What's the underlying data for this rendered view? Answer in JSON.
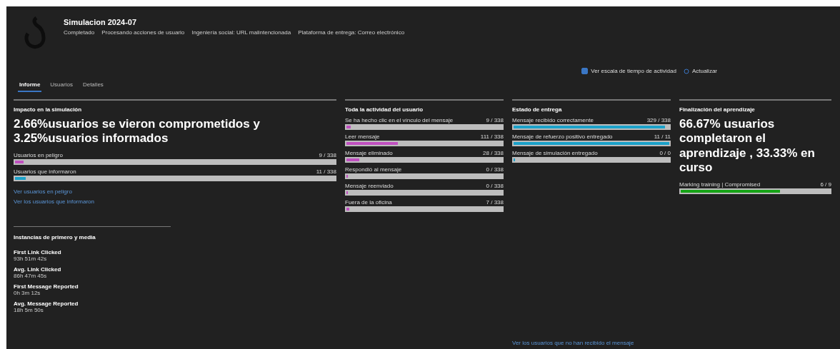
{
  "header": {
    "title": "Simulacion 2024-07",
    "meta": [
      "Completado",
      "Procesando acciones de usuario",
      "Ingeniería social: URL malintencionada",
      "Plataforma de entrega: Correo electrónico"
    ]
  },
  "toolbar": {
    "timeline": {
      "label": "Ver escala de tiempo de actividad",
      "checked": true
    },
    "refresh": "Actualizar"
  },
  "tabs": [
    {
      "label": "Informe",
      "selected": true
    },
    {
      "label": "Usuarios",
      "selected": false
    },
    {
      "label": "Detalles",
      "selected": false
    }
  ],
  "impact": {
    "title": "Impacto en la simulación",
    "headline": "2.66%usuarios se vieron comprometidos y 3.25%usuarios informados",
    "bars": [
      {
        "label": "Usuarios en peligro",
        "value": "9 / 338",
        "level": 0.027,
        "color": "#c050c0"
      },
      {
        "label": "Usuarios que informaron",
        "value": "11 / 338",
        "level": 0.033,
        "color": "#1ba1c9"
      }
    ],
    "links": [
      "Ver usuarios en peligro",
      "Ver los usuarios que informaron"
    ]
  },
  "timing": {
    "title": "Instancias de primero y media",
    "items": [
      {
        "label": "First Link Clicked",
        "value": "93h 51m 42s"
      },
      {
        "label": "Avg. Link Clicked",
        "value": "86h 47m 45s"
      },
      {
        "label": "First Message Reported",
        "value": "0h 3m 12s"
      },
      {
        "label": "Avg. Message Reported",
        "value": "18h 5m 50s"
      }
    ]
  },
  "activity": {
    "title": "Toda la actividad del usuario",
    "bars": [
      {
        "label": "Se ha hecho clic en el vínculo del mensaje",
        "value": "9 / 338",
        "level": 0.027,
        "color": "#c050c0"
      },
      {
        "label": "Leer mensaje",
        "value": "111 / 338",
        "level": 0.33,
        "color": "#c050c0"
      },
      {
        "label": "Mensaje eliminado",
        "value": "28 / 338",
        "level": 0.083,
        "color": "#c050c0"
      },
      {
        "label": "Respondió al mensaje",
        "value": "0 / 338",
        "level": 0,
        "color": "#c050c0"
      },
      {
        "label": "Mensaje reenviado",
        "value": "0 / 338",
        "level": 0,
        "color": "#c050c0"
      },
      {
        "label": "Fuera de la oficina",
        "value": "7 / 338",
        "level": 0.02,
        "color": "#c050c0"
      }
    ]
  },
  "delivery": {
    "title": "Estado de entrega",
    "bars": [
      {
        "label": "Mensaje recibido correctamente",
        "value": "329 / 338",
        "level": 0.973,
        "color": "#1ba1c9"
      },
      {
        "label": "Mensaje de refuerzo positivo entregado",
        "value": "11 / 11",
        "level": 1,
        "color": "#1ba1c9"
      },
      {
        "label": "Mensaje de simulación entregado",
        "value": "0 / 0",
        "level": 0,
        "color": "#1ba1c9"
      }
    ],
    "link": "Ver los usuarios que no han recibido el mensaje"
  },
  "training": {
    "title": "Finalización del aprendizaje",
    "headline": "66.67% usuarios completaron el aprendizaje , 33.33% en curso",
    "bars": [
      {
        "label": "Marking training | Compromised",
        "value": "6 / 9",
        "level": 0.667,
        "color": "#16a316"
      }
    ]
  }
}
